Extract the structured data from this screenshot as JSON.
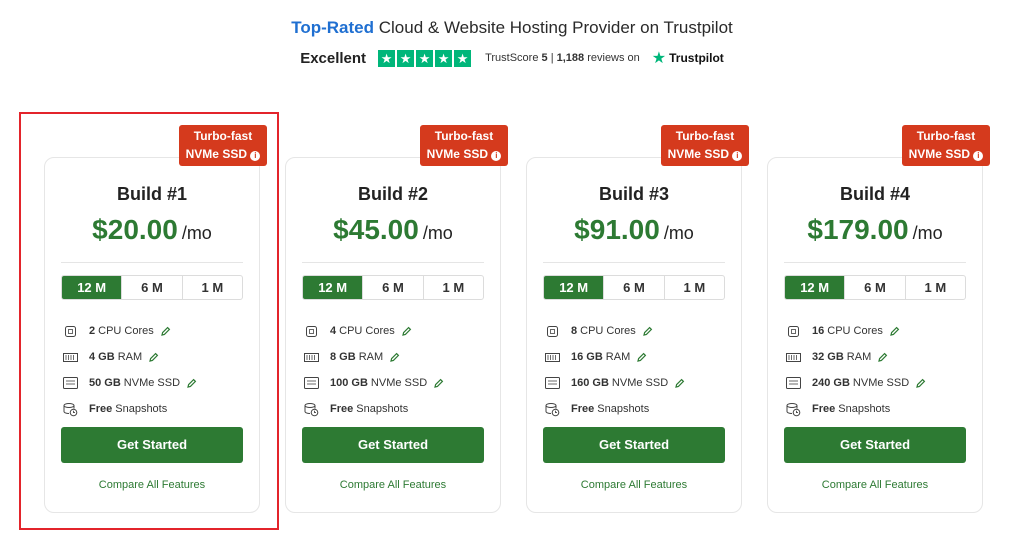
{
  "header": {
    "headline_accent": "Top-Rated",
    "headline_rest": " Cloud & Website Hosting Provider on Trustpilot"
  },
  "trust": {
    "rating_word": "Excellent",
    "stars": 5,
    "trustscore_label": "TrustScore",
    "trustscore_value": "5",
    "separator": "|",
    "review_count": "1,188",
    "reviews_on": "reviews on",
    "brand": "Trustpilot",
    "brand_color": "#00b67a"
  },
  "colors": {
    "accent_green": "#2d7a33",
    "badge_red": "#d53a1d",
    "highlight_red": "#e3242b",
    "headline_blue": "#1f6fd1"
  },
  "plans": [
    {
      "badge_line1": "Turbo-fast",
      "badge_line2": "NVMe SSD",
      "title": "Build #1",
      "price": "$20.00",
      "period": "/mo",
      "terms": [
        "12 M",
        "6 M",
        "1 M"
      ],
      "active_term": "12 M",
      "features": [
        {
          "icon": "cpu-icon",
          "bold": "2",
          "text": "CPU Cores",
          "editable": true
        },
        {
          "icon": "ram-icon",
          "bold": "4 GB",
          "text": "RAM",
          "editable": true
        },
        {
          "icon": "ssd-icon",
          "bold": "50 GB",
          "text": "NVMe SSD",
          "editable": true
        },
        {
          "icon": "snapshot-icon",
          "bold": "Free",
          "text": "Snapshots",
          "editable": false
        }
      ],
      "cta": "Get Started",
      "compare": "Compare All Features"
    },
    {
      "badge_line1": "Turbo-fast",
      "badge_line2": "NVMe SSD",
      "title": "Build #2",
      "price": "$45.00",
      "period": "/mo",
      "terms": [
        "12 M",
        "6 M",
        "1 M"
      ],
      "active_term": "12 M",
      "features": [
        {
          "icon": "cpu-icon",
          "bold": "4",
          "text": "CPU Cores",
          "editable": true
        },
        {
          "icon": "ram-icon",
          "bold": "8 GB",
          "text": "RAM",
          "editable": true
        },
        {
          "icon": "ssd-icon",
          "bold": "100 GB",
          "text": "NVMe SSD",
          "editable": true
        },
        {
          "icon": "snapshot-icon",
          "bold": "Free",
          "text": "Snapshots",
          "editable": false
        }
      ],
      "cta": "Get Started",
      "compare": "Compare All Features"
    },
    {
      "badge_line1": "Turbo-fast",
      "badge_line2": "NVMe SSD",
      "title": "Build #3",
      "price": "$91.00",
      "period": "/mo",
      "terms": [
        "12 M",
        "6 M",
        "1 M"
      ],
      "active_term": "12 M",
      "features": [
        {
          "icon": "cpu-icon",
          "bold": "8",
          "text": "CPU Cores",
          "editable": true
        },
        {
          "icon": "ram-icon",
          "bold": "16 GB",
          "text": "RAM",
          "editable": true
        },
        {
          "icon": "ssd-icon",
          "bold": "160 GB",
          "text": "NVMe SSD",
          "editable": true
        },
        {
          "icon": "snapshot-icon",
          "bold": "Free",
          "text": "Snapshots",
          "editable": false
        }
      ],
      "cta": "Get Started",
      "compare": "Compare All Features"
    },
    {
      "badge_line1": "Turbo-fast",
      "badge_line2": "NVMe SSD",
      "title": "Build #4",
      "price": "$179.00",
      "period": "/mo",
      "terms": [
        "12 M",
        "6 M",
        "1 M"
      ],
      "active_term": "12 M",
      "features": [
        {
          "icon": "cpu-icon",
          "bold": "16",
          "text": "CPU Cores",
          "editable": true
        },
        {
          "icon": "ram-icon",
          "bold": "32 GB",
          "text": "RAM",
          "editable": true
        },
        {
          "icon": "ssd-icon",
          "bold": "240 GB",
          "text": "NVMe SSD",
          "editable": true
        },
        {
          "icon": "snapshot-icon",
          "bold": "Free",
          "text": "Snapshots",
          "editable": false
        }
      ],
      "cta": "Get Started",
      "compare": "Compare All Features"
    }
  ]
}
